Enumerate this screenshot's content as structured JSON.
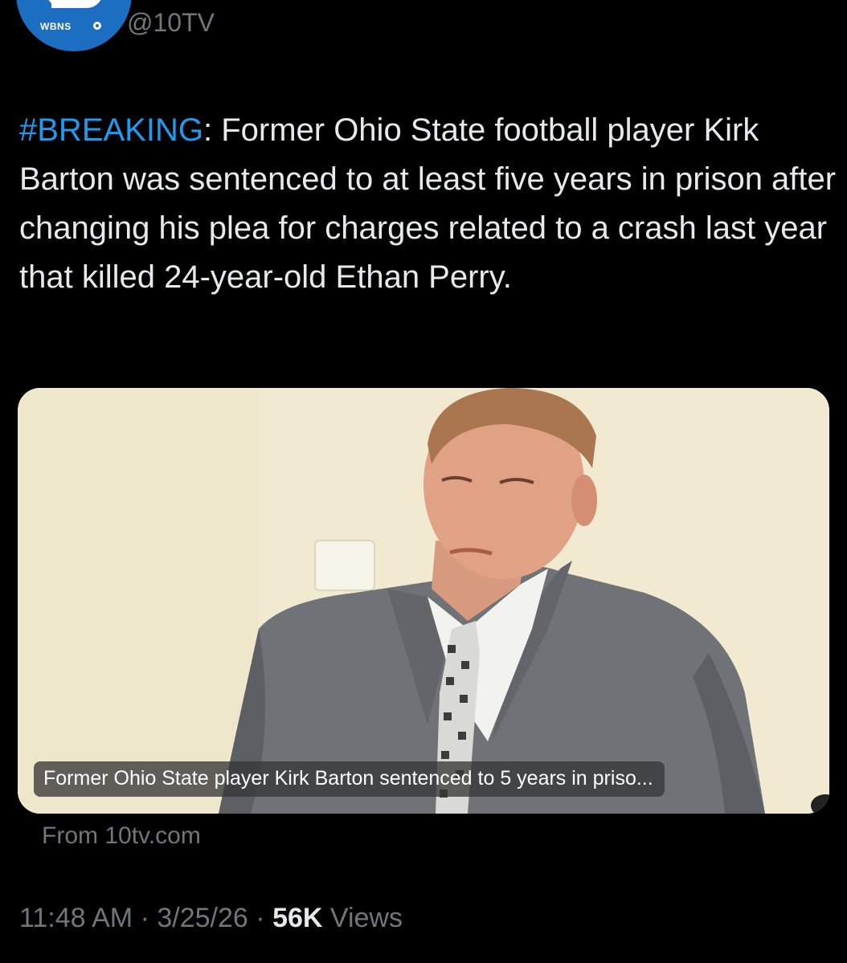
{
  "account": {
    "avatar_label": "WBNS",
    "avatar_icon": "cbs-eye-icon",
    "handle": "@10TV"
  },
  "tweet": {
    "hashtag": "#BREAKING",
    "text": ": Former Ohio State football player Kirk Barton was sentenced to at least five years in prison after changing his plea for charges related to a crash last year that killed 24-year-old Ethan Perry."
  },
  "link_card": {
    "caption": "Former Ohio State player Kirk Barton sentenced to 5 years in priso...",
    "source": "From 10tv.com"
  },
  "meta": {
    "time": "11:48 AM",
    "separator": "·",
    "date": "3/25/26",
    "views_count": "56K",
    "views_label": "Views"
  },
  "colors": {
    "background": "#000000",
    "text": "#e7e9ea",
    "secondary_text": "#71767b",
    "hashtag": "#1d9bf0",
    "avatar": "#1b6ec2"
  }
}
